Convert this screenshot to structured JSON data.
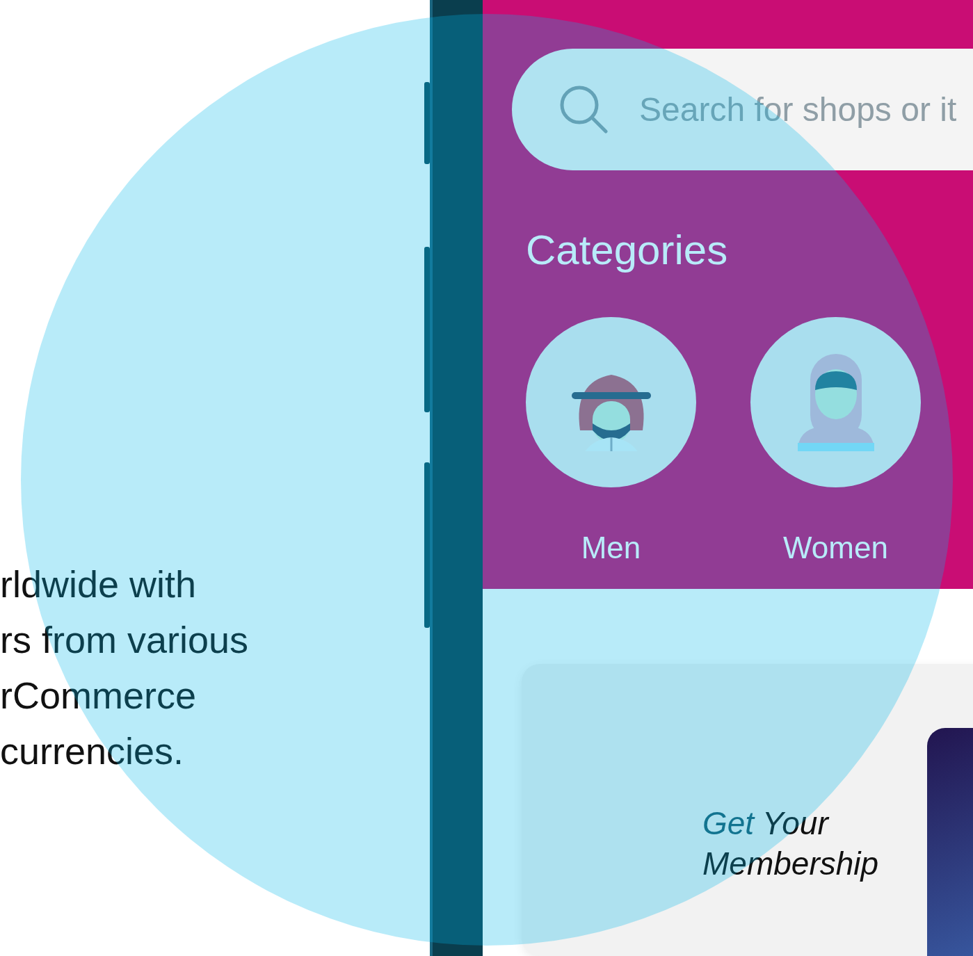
{
  "intro_text": [
    "rldwide with",
    "rs from various",
    "rCommerce",
    "currencies."
  ],
  "search": {
    "placeholder": "Search for shops or it"
  },
  "categories": {
    "title": "Categories",
    "items": [
      {
        "label": "Men",
        "kind": "man"
      },
      {
        "label": "Women",
        "kind": "woman"
      }
    ]
  },
  "banner": {
    "title_lead": "Get",
    "title_rest": "Your",
    "subtitle": "Membership"
  }
}
